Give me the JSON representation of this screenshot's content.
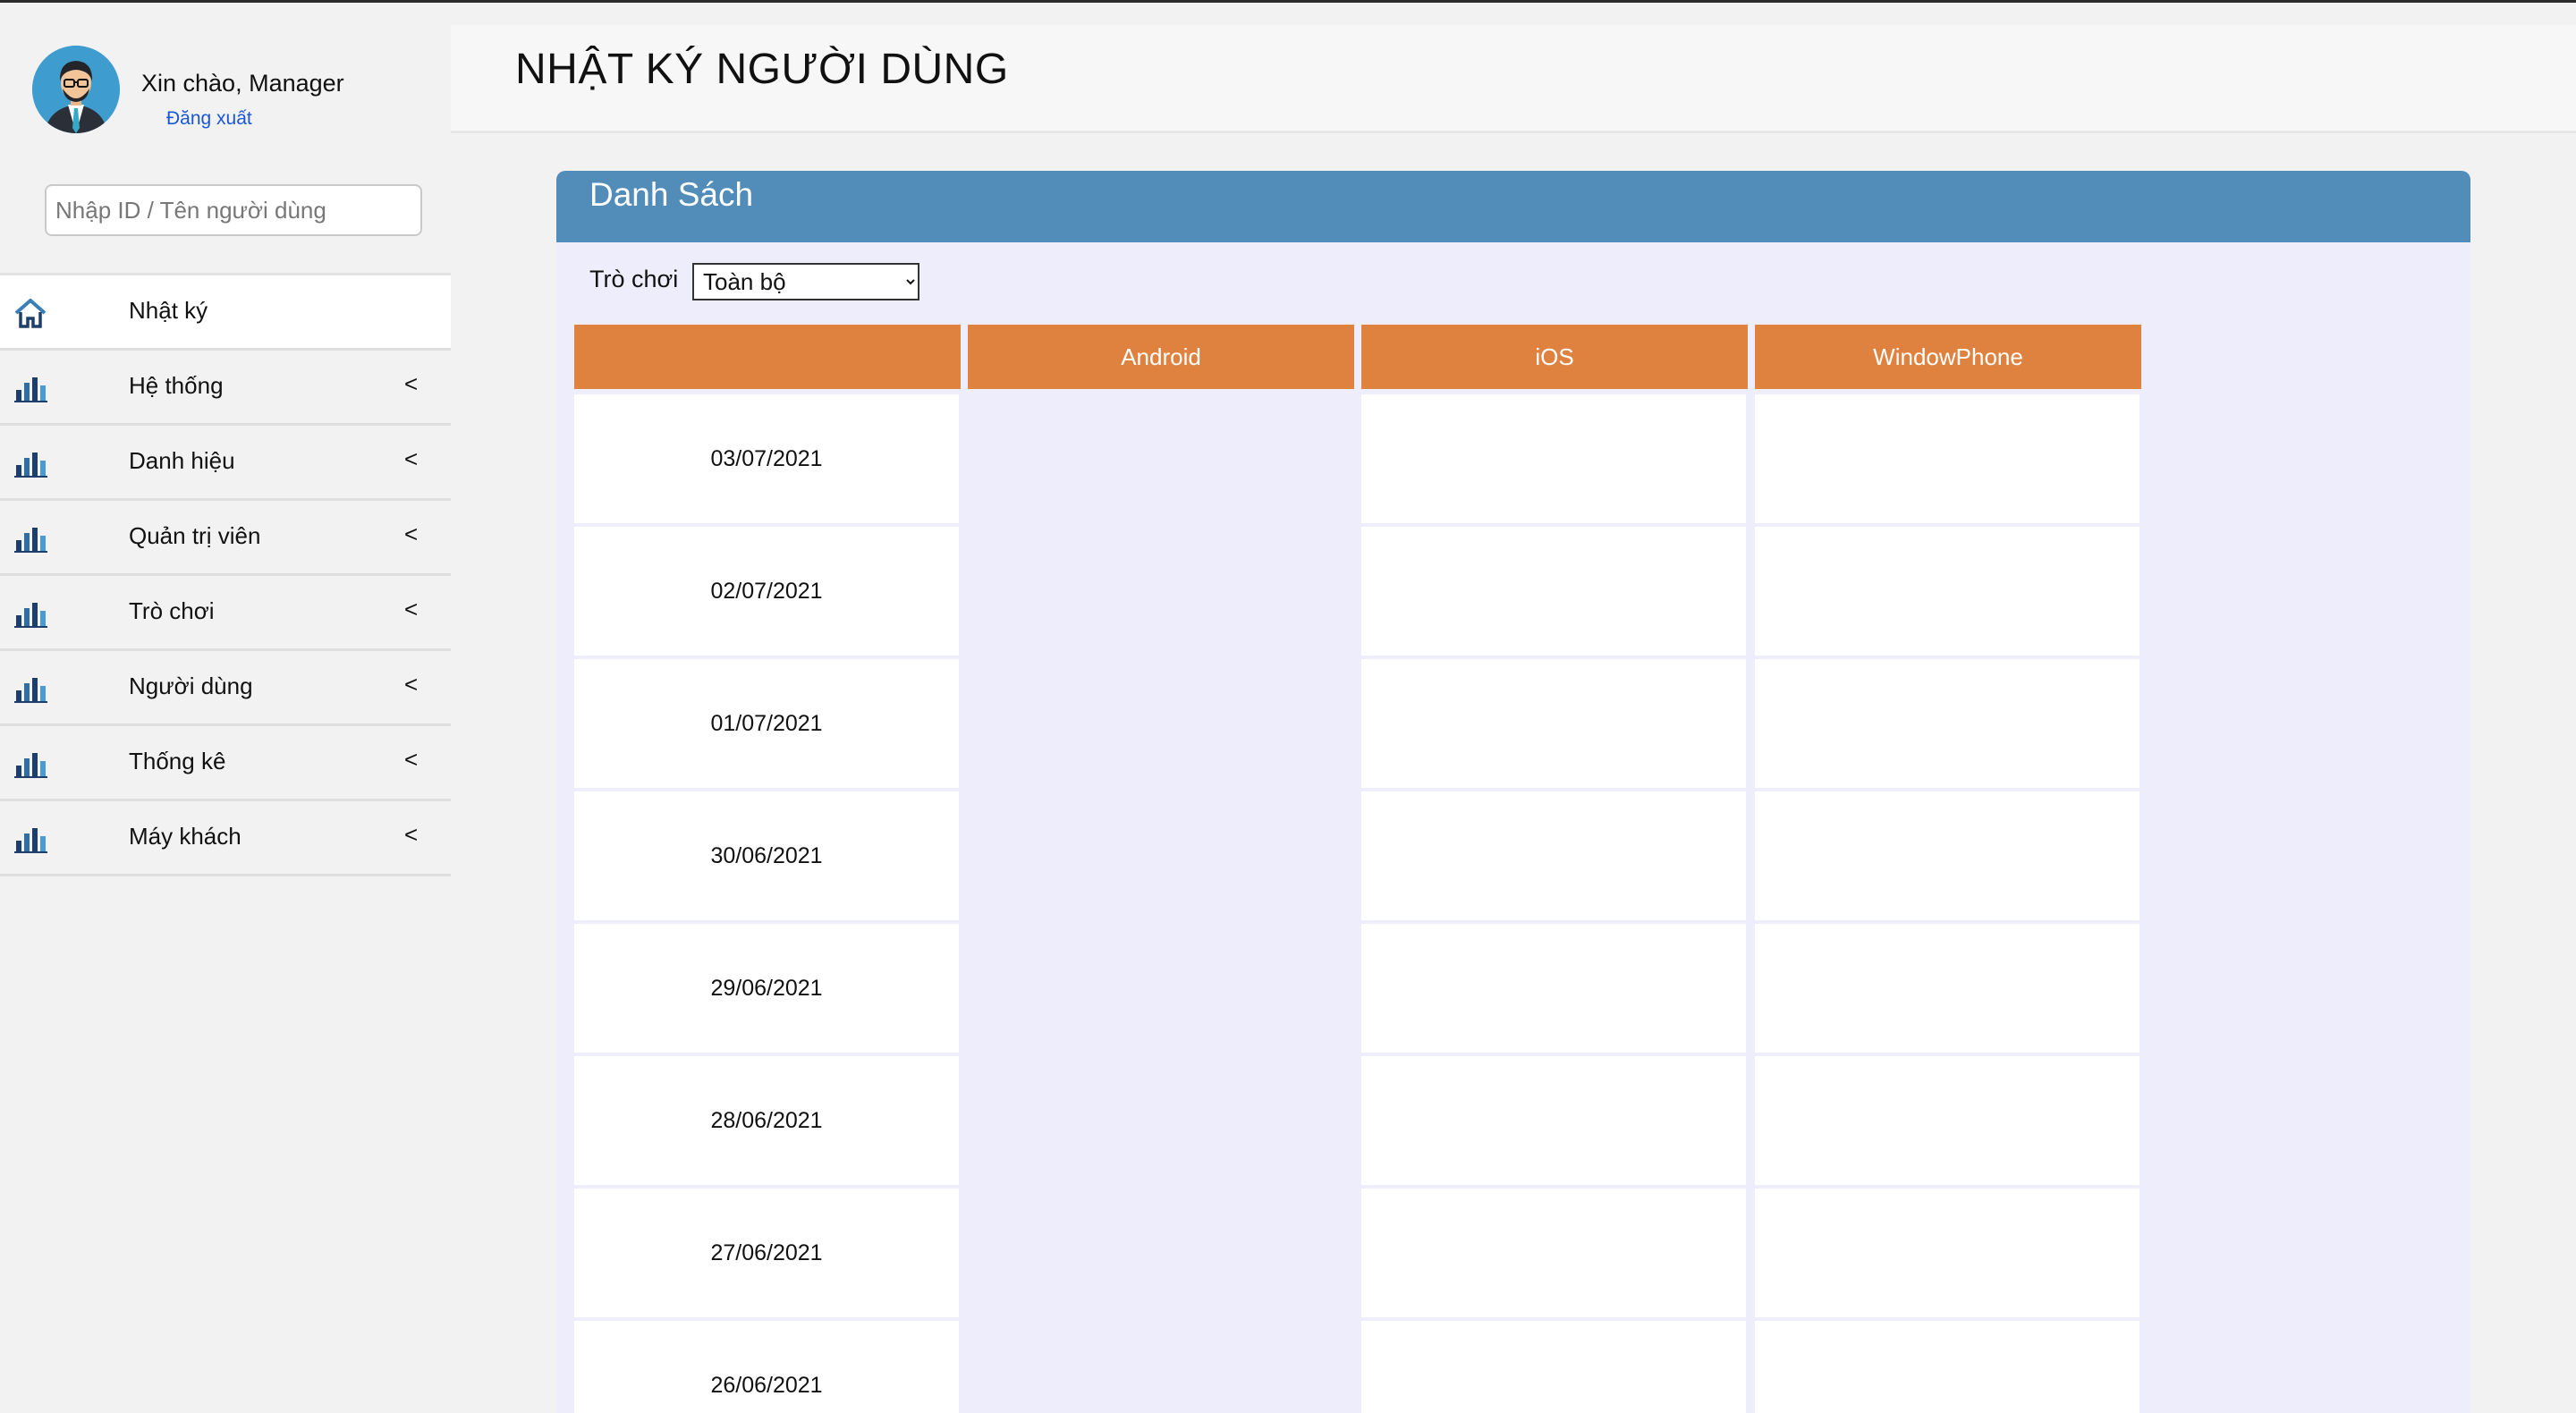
{
  "sidebar": {
    "greeting": "Xin chào, Manager",
    "logout_label": "Đăng xuất",
    "search_placeholder": "Nhập ID / Tên người dùng",
    "menu": [
      {
        "label": "Nhật ký",
        "icon": "home-icon",
        "active": true,
        "chevron": ""
      },
      {
        "label": "Hệ thống",
        "icon": "bar-chart-icon",
        "active": false,
        "chevron": "<"
      },
      {
        "label": "Danh hiệu",
        "icon": "bar-chart-icon",
        "active": false,
        "chevron": "<"
      },
      {
        "label": "Quản trị viên",
        "icon": "bar-chart-icon",
        "active": false,
        "chevron": "<"
      },
      {
        "label": "Trò chơi",
        "icon": "bar-chart-icon",
        "active": false,
        "chevron": "<"
      },
      {
        "label": "Người dùng",
        "icon": "bar-chart-icon",
        "active": false,
        "chevron": "<"
      },
      {
        "label": "Thống kê",
        "icon": "bar-chart-icon",
        "active": false,
        "chevron": "<"
      },
      {
        "label": "Máy khách",
        "icon": "bar-chart-icon",
        "active": false,
        "chevron": "<"
      }
    ]
  },
  "header": {
    "title": "NHẬT KÝ NGƯỜI DÙNG"
  },
  "panel": {
    "title": "Danh Sách",
    "filter_label": "Trò chơi",
    "filter_selected": "Toàn bộ",
    "columns": [
      "",
      "Android",
      "iOS",
      "WindowPhone"
    ],
    "rows": [
      {
        "date": "03/07/2021",
        "android": "",
        "ios": "",
        "windowphone": ""
      },
      {
        "date": "02/07/2021",
        "android": "",
        "ios": "",
        "windowphone": ""
      },
      {
        "date": "01/07/2021",
        "android": "",
        "ios": "",
        "windowphone": ""
      },
      {
        "date": "30/06/2021",
        "android": "",
        "ios": "",
        "windowphone": ""
      },
      {
        "date": "29/06/2021",
        "android": "",
        "ios": "",
        "windowphone": ""
      },
      {
        "date": "28/06/2021",
        "android": "",
        "ios": "",
        "windowphone": ""
      },
      {
        "date": "27/06/2021",
        "android": "",
        "ios": "",
        "windowphone": ""
      },
      {
        "date": "26/06/2021",
        "android": "",
        "ios": "",
        "windowphone": ""
      }
    ]
  },
  "colors": {
    "header_bar": "#528cb8",
    "column_header": "#e0823f",
    "panel_bg": "#eeedfc",
    "logout_link": "#1a56d6"
  }
}
